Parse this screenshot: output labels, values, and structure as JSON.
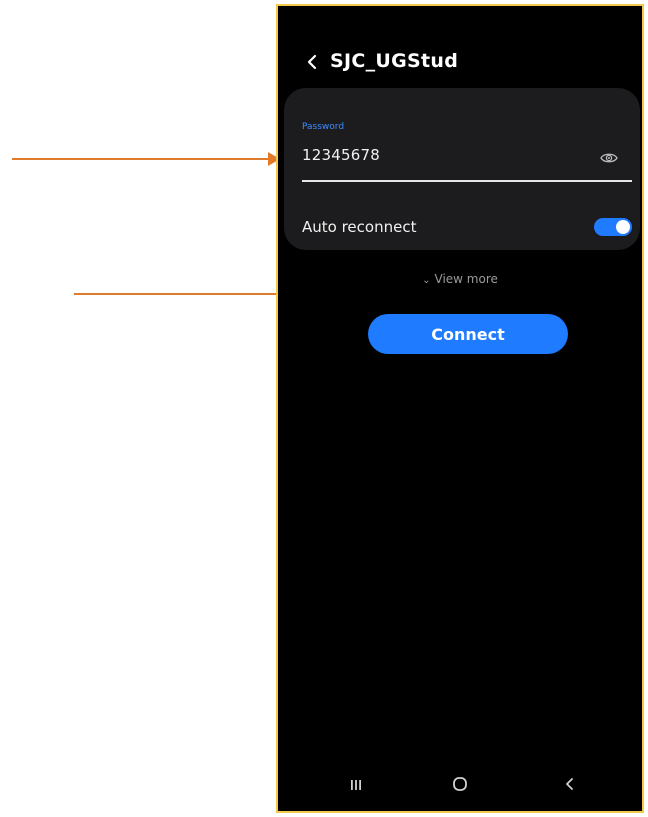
{
  "header": {
    "title": "SJC_UGStud"
  },
  "password": {
    "label": "Password",
    "value": "12345678"
  },
  "auto_reconnect": {
    "label": "Auto reconnect",
    "enabled": true
  },
  "view_more": {
    "label": "View more"
  },
  "connect": {
    "label": "Connect"
  },
  "colors": {
    "accent": "#1f7bff",
    "annotation": "#e07b2c",
    "frame": "#f2c94c",
    "background": "#000000",
    "card": "#1c1c1e"
  },
  "icons": {
    "back": "back-chevron-icon",
    "password_visibility": "eye-icon",
    "view_more": "chevron-down-icon",
    "nav_recents": "recents-icon",
    "nav_home": "home-icon",
    "nav_back": "back-icon"
  }
}
